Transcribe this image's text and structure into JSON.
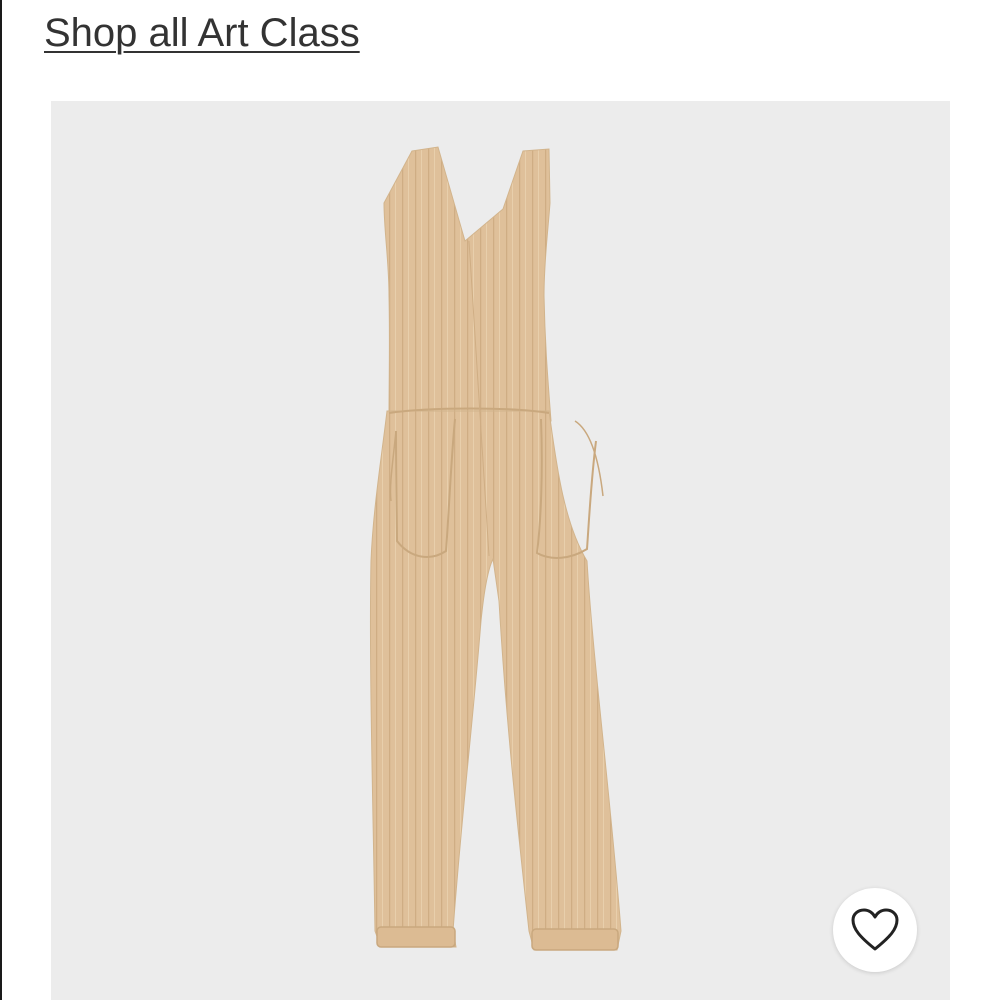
{
  "header": {
    "shop_link_label": "Shop all Art Class"
  },
  "product": {
    "image_icon": "jumpsuit-image",
    "garment_color": "#dfc09a",
    "background_color": "#ececec",
    "favorite_icon": "heart-icon"
  }
}
